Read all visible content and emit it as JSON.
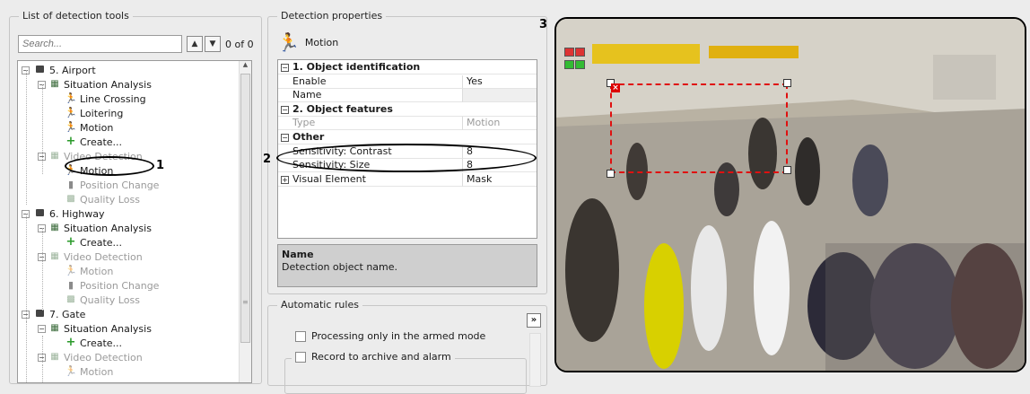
{
  "colors": {
    "accent_red": "#e01010",
    "window_bg": "#ececec"
  },
  "left_panel": {
    "title": "List of detection tools",
    "search": {
      "placeholder": "Search...",
      "value": ""
    },
    "up_icon": "chevron-up-icon",
    "down_icon": "chevron-down-icon",
    "match_count": "0 of 0",
    "tree": [
      {
        "label": "5. Airport",
        "icon": "camera-icon",
        "expander": "−",
        "disabled": false
      },
      {
        "label": "Situation Analysis",
        "icon": "situation-analysis-icon",
        "expander": "−",
        "disabled": false
      },
      {
        "label": "Line Crossing",
        "icon": "running-man-icon",
        "disabled": false
      },
      {
        "label": "Loitering",
        "icon": "running-man-icon",
        "disabled": false
      },
      {
        "label": "Motion",
        "icon": "running-man-icon",
        "disabled": false
      },
      {
        "label": "Create...",
        "icon": "plus-icon",
        "disabled": false
      },
      {
        "label": "Video Detection",
        "icon": "video-detection-icon",
        "expander": "−",
        "disabled": true
      },
      {
        "label": "Motion",
        "icon": "running-man-icon",
        "disabled": false,
        "selected": true
      },
      {
        "label": "Position Change",
        "icon": "position-change-icon",
        "disabled": true
      },
      {
        "label": "Quality Loss",
        "icon": "quality-loss-icon",
        "disabled": true
      },
      {
        "label": "6. Highway",
        "icon": "camera-icon",
        "expander": "−",
        "disabled": false
      },
      {
        "label": "Situation Analysis",
        "icon": "situation-analysis-icon",
        "expander": "−",
        "disabled": false
      },
      {
        "label": "Create...",
        "icon": "plus-icon",
        "disabled": false
      },
      {
        "label": "Video Detection",
        "icon": "video-detection-icon",
        "expander": "−",
        "disabled": true
      },
      {
        "label": "Motion",
        "icon": "running-man-icon",
        "disabled": true
      },
      {
        "label": "Position Change",
        "icon": "position-change-icon",
        "disabled": true
      },
      {
        "label": "Quality Loss",
        "icon": "quality-loss-icon",
        "disabled": true
      },
      {
        "label": "7. Gate",
        "icon": "camera-icon",
        "expander": "−",
        "disabled": false
      },
      {
        "label": "Situation Analysis",
        "icon": "situation-analysis-icon",
        "expander": "−",
        "disabled": false
      },
      {
        "label": "Create...",
        "icon": "plus-icon",
        "disabled": false
      },
      {
        "label": "Video Detection",
        "icon": "video-detection-icon",
        "expander": "−",
        "disabled": true
      },
      {
        "label": "Motion",
        "icon": "running-man-icon",
        "disabled": true
      }
    ]
  },
  "properties": {
    "title": "Detection properties",
    "tool_name": "Motion",
    "rows": [
      {
        "kind": "category",
        "label": "1. Object identification",
        "value": ""
      },
      {
        "kind": "item",
        "label": "Enable",
        "value": "Yes"
      },
      {
        "kind": "item",
        "label": "Name",
        "value": ""
      },
      {
        "kind": "category",
        "label": "2. Object features",
        "value": ""
      },
      {
        "kind": "item",
        "label": "Type",
        "value": "Motion",
        "disabled": true
      },
      {
        "kind": "category",
        "label": "Other",
        "value": ""
      },
      {
        "kind": "item",
        "label": "Sensitivity: Contrast",
        "value": "8"
      },
      {
        "kind": "item",
        "label": "Sensitivity: Size",
        "value": "8"
      },
      {
        "kind": "subgroup",
        "label": "Visual Element",
        "value": "Mask",
        "expander": "+"
      }
    ],
    "description": {
      "title": "Name",
      "text": "Detection object name."
    }
  },
  "rules": {
    "title": "Automatic rules",
    "expand_label": "»",
    "armed_only_label": "Processing only in the armed mode",
    "record_label": "Record to archive and alarm",
    "armed_only_checked": false,
    "record_checked": false
  },
  "callouts": [
    "1",
    "2",
    "3"
  ],
  "video": {
    "close_marker": "×"
  }
}
